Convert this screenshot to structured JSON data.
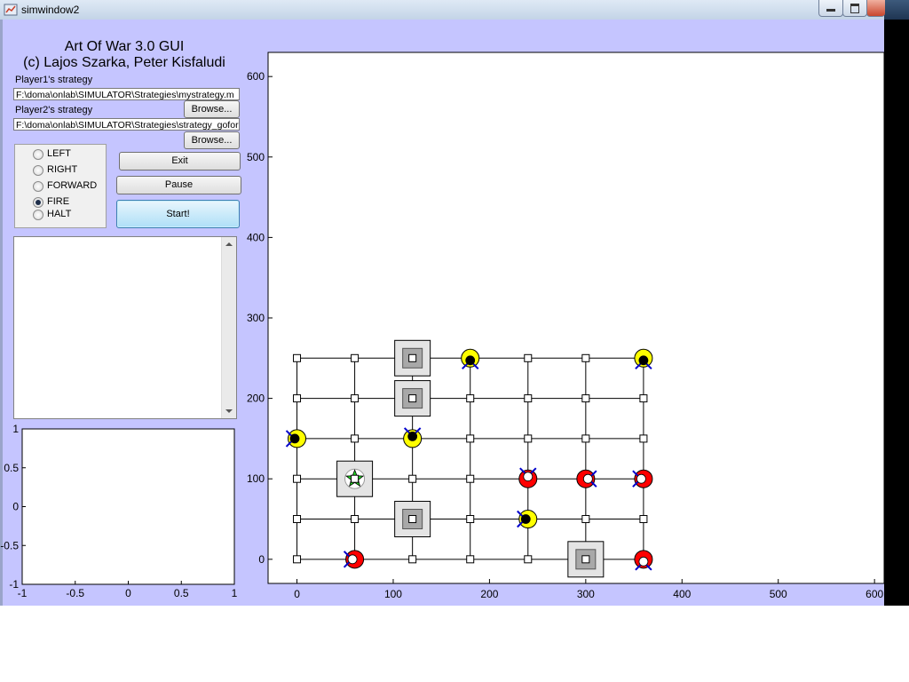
{
  "window": {
    "title": "simwindow2"
  },
  "header": {
    "title": "Art Of War 3.0 GUI",
    "credits": "(c) Lajos Szarka, Peter Kisfaludi"
  },
  "player1": {
    "label": "Player1's strategy",
    "path": "F:\\doma\\onlab\\SIMULATOR\\Strategies\\mystrategy.m",
    "browse_label": "Browse..."
  },
  "player2": {
    "label": "Player2's strategy",
    "path": "F:\\doma\\onlab\\SIMULATOR\\Strategies\\strategy_gofor",
    "browse_label": "Browse..."
  },
  "commands": {
    "options": [
      "LEFT",
      "RIGHT",
      "FORWARD",
      "FIRE",
      "HALT"
    ],
    "selected": "FIRE"
  },
  "buttons": {
    "exit": "Exit",
    "pause": "Pause",
    "start": "Start!"
  },
  "colors": {
    "figure_bg": "#c5c5ff",
    "team_yellow": "#ffff00",
    "team_red": "#ff0000",
    "turret": "#0000cc",
    "wall": "#d9d9d9"
  },
  "mini_plot": {
    "xticks": [
      "-1",
      "-0.5",
      "0",
      "0.5",
      "1"
    ],
    "yticks": [
      "1",
      "0.5",
      "0",
      "-0.5",
      "-1"
    ],
    "xlim": [
      -1,
      1
    ],
    "ylim": [
      -1,
      1
    ]
  },
  "chart_data": {
    "type": "scatter",
    "xlim": [
      -30,
      610
    ],
    "ylim": [
      -30,
      630
    ],
    "xticks": [
      0,
      100,
      200,
      300,
      400,
      500,
      600
    ],
    "yticks": [
      0,
      100,
      200,
      300,
      400,
      500,
      600
    ],
    "xtick_labels": [
      "0",
      "100",
      "200",
      "300",
      "400",
      "500",
      "600"
    ],
    "ytick_labels": [
      "0",
      "100",
      "200",
      "300",
      "400",
      "500",
      "600"
    ],
    "grid": {
      "x": [
        0,
        60,
        120,
        180,
        240,
        300,
        360
      ],
      "y": [
        0,
        50,
        100,
        150,
        200,
        250
      ]
    },
    "walls": [
      {
        "x": 120,
        "y": 250
      },
      {
        "x": 120,
        "y": 200
      },
      {
        "x": 60,
        "y": 100,
        "goal": true
      },
      {
        "x": 120,
        "y": 50
      },
      {
        "x": 300,
        "y": 0
      }
    ],
    "tanks": [
      {
        "team": "yellow",
        "x": 180,
        "y": 250,
        "dir": "down"
      },
      {
        "team": "yellow",
        "x": 360,
        "y": 250,
        "dir": "down"
      },
      {
        "team": "yellow",
        "x": 0,
        "y": 150,
        "dir": "left"
      },
      {
        "team": "yellow",
        "x": 120,
        "y": 150,
        "dir": "up"
      },
      {
        "team": "yellow",
        "x": 240,
        "y": 50,
        "dir": "left"
      },
      {
        "team": "red",
        "x": 240,
        "y": 100,
        "dir": "up"
      },
      {
        "team": "red",
        "x": 300,
        "y": 100,
        "dir": "right"
      },
      {
        "team": "red",
        "x": 360,
        "y": 100,
        "dir": "left"
      },
      {
        "team": "red",
        "x": 60,
        "y": 0,
        "dir": "left"
      },
      {
        "team": "red",
        "x": 360,
        "y": 0,
        "dir": "down"
      }
    ]
  }
}
